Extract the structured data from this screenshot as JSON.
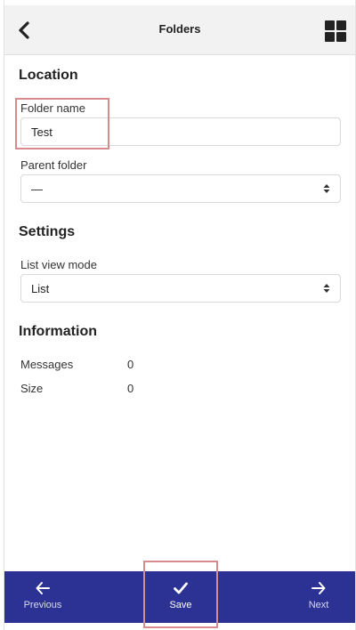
{
  "header": {
    "title": "Folders",
    "back_icon": "chevron-left-icon",
    "apps_icon": "grid-icon"
  },
  "location": {
    "heading": "Location",
    "folder_name_label": "Folder name",
    "folder_name_value": "Test",
    "parent_folder_label": "Parent folder",
    "parent_folder_value": "—"
  },
  "settings": {
    "heading": "Settings",
    "list_view_mode_label": "List view mode",
    "list_view_mode_value": "List"
  },
  "information": {
    "heading": "Information",
    "rows": [
      {
        "label": "Messages",
        "value": "0"
      },
      {
        "label": "Size",
        "value": "0"
      }
    ]
  },
  "bottom_nav": {
    "previous_label": "Previous",
    "save_label": "Save",
    "next_label": "Next",
    "background": "#2b3294"
  },
  "colors": {
    "highlight": "#d98a8f"
  }
}
